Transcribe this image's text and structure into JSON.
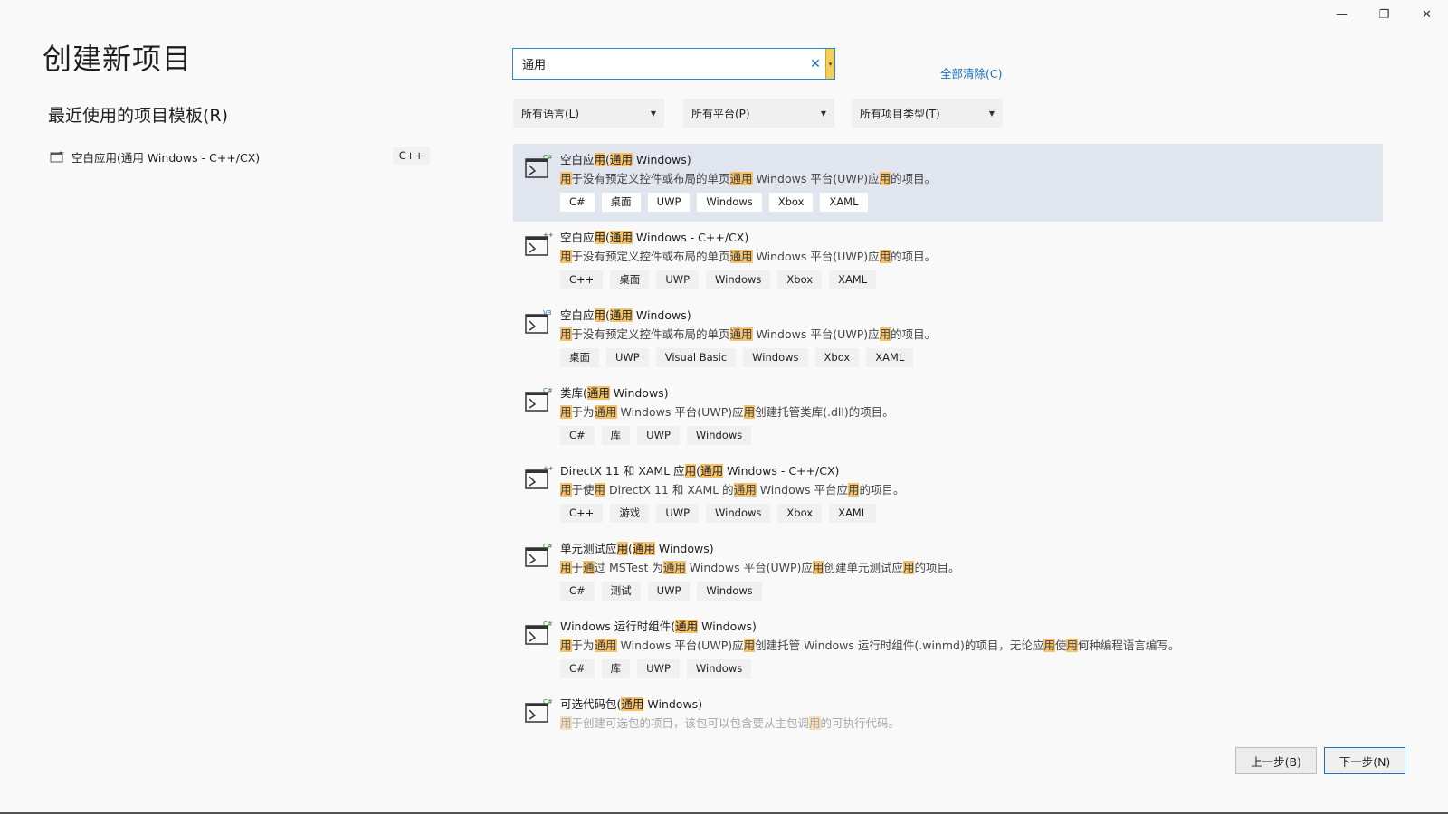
{
  "window": {
    "minimize": "—",
    "restore": "❐",
    "close": "✕"
  },
  "page_title": "创建新项目",
  "recent": {
    "heading": "最近使用的项目模板(R)",
    "items": [
      {
        "label": "空白应用(通用 Windows - C++/CX)",
        "tag": "C++"
      }
    ]
  },
  "search": {
    "value": "通用",
    "clear_icon": "✕",
    "dropdown_icon": "▾"
  },
  "clear_all": "全部清除(C)",
  "filters": [
    {
      "label": "所有语言(L)"
    },
    {
      "label": "所有平台(P)"
    },
    {
      "label": "所有项目类型(T)"
    }
  ],
  "colors": {
    "accent": "#1a6fc4",
    "selected_row": "#e1e5ee",
    "highlight": "#f5c26b"
  },
  "results": [
    {
      "title": "空白应用(通用 Windows)",
      "desc": "用于没有预定义控件或布局的单页通用 Windows 平台(UWP)应用的项目。",
      "tags": [
        "C#",
        "桌面",
        "UWP",
        "Windows",
        "Xbox",
        "XAML"
      ],
      "icon": "cs-window-icon",
      "badge": "C#"
    },
    {
      "title": "空白应用(通用 Windows - C++/CX)",
      "desc": "用于没有预定义控件或布局的单页通用 Windows 平台(UWP)应用的项目。",
      "tags": [
        "C++",
        "桌面",
        "UWP",
        "Windows",
        "Xbox",
        "XAML"
      ],
      "icon": "cpp-window-icon",
      "badge": "++"
    },
    {
      "title": "空白应用(通用 Windows)",
      "desc": "用于没有预定义控件或布局的单页通用 Windows 平台(UWP)应用的项目。",
      "tags": [
        "桌面",
        "UWP",
        "Visual Basic",
        "Windows",
        "Xbox",
        "XAML"
      ],
      "icon": "vb-window-icon",
      "badge": "VB"
    },
    {
      "title": "类库(通用 Windows)",
      "desc": "用于为通用 Windows 平台(UWP)应用创建托管类库(.dll)的项目。",
      "tags": [
        "C#",
        "库",
        "UWP",
        "Windows"
      ],
      "icon": "cs-library-icon",
      "badge": "C#"
    },
    {
      "title": "DirectX 11 和 XAML 应用(通用 Windows - C++/CX)",
      "desc": "用于使用 DirectX 11 和 XAML 的通用 Windows 平台应用的项目。",
      "tags": [
        "C++",
        "游戏",
        "UWP",
        "Windows",
        "Xbox",
        "XAML"
      ],
      "icon": "cpp-directx-icon",
      "badge": "++"
    },
    {
      "title": "单元测试应用(通用 Windows)",
      "desc": "用于通过 MSTest 为通用 Windows 平台(UWP)应用创建单元测试应用的项目。",
      "tags": [
        "C#",
        "测试",
        "UWP",
        "Windows"
      ],
      "icon": "cs-test-icon",
      "badge": "C#"
    },
    {
      "title": "Windows 运行时组件(通用 Windows)",
      "desc": "用于为通用 Windows 平台(UWP)应用创建托管 Windows 运行时组件(.winmd)的项目，无论应用使用何种编程语言编写。",
      "tags": [
        "C#",
        "库",
        "UWP",
        "Windows"
      ],
      "icon": "cs-component-icon",
      "badge": "C#"
    },
    {
      "title": "可选代码包(通用 Windows)",
      "desc": "用于创建可选包的项目，该包可以包含要从主包调用的可执行代码。",
      "tags": [],
      "icon": "cs-package-icon",
      "badge": "C#"
    }
  ],
  "buttons": {
    "back": "上一步(B)",
    "next": "下一步(N)"
  }
}
